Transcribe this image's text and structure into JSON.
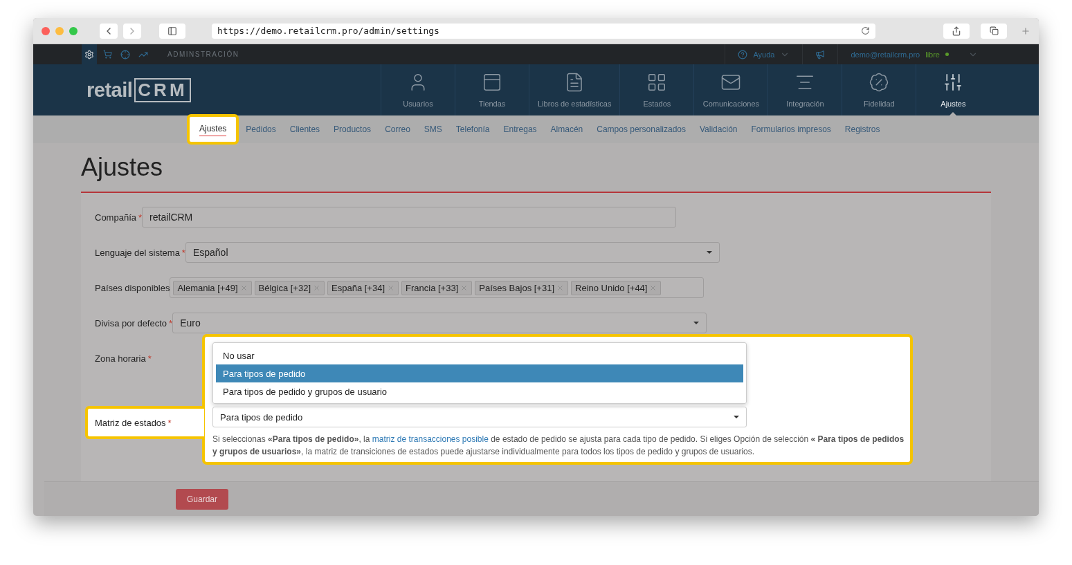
{
  "browser": {
    "url": "https://demo.retailcrm.pro/admin/settings"
  },
  "topbar": {
    "section": "ADMINSTRACIÓN",
    "help": "Ayuda",
    "email": "demo@retailcrm.pro",
    "plan": "libre"
  },
  "logo": {
    "word": "retail",
    "mark": "CRM"
  },
  "nav": [
    {
      "label": "Usuarios",
      "kind": "user",
      "selected": false
    },
    {
      "label": "Tiendas",
      "kind": "store",
      "selected": false
    },
    {
      "label": "Libros de estadísticas",
      "kind": "book",
      "selected": false
    },
    {
      "label": "Estados",
      "kind": "grid",
      "selected": false
    },
    {
      "label": "Comunicaciones",
      "kind": "mail",
      "selected": false
    },
    {
      "label": "Integración",
      "kind": "lines",
      "selected": false
    },
    {
      "label": "Fidelidad",
      "kind": "percent",
      "selected": false
    },
    {
      "label": "Ajustes",
      "kind": "sliders",
      "selected": true
    }
  ],
  "tabs": [
    {
      "label": "Ajustes",
      "selected": true
    },
    {
      "label": "Pedidos",
      "selected": false
    },
    {
      "label": "Clientes",
      "selected": false
    },
    {
      "label": "Productos",
      "selected": false
    },
    {
      "label": "Correo",
      "selected": false
    },
    {
      "label": "SMS",
      "selected": false
    },
    {
      "label": "Telefonía",
      "selected": false
    },
    {
      "label": "Entregas",
      "selected": false
    },
    {
      "label": "Almacén",
      "selected": false
    },
    {
      "label": "Campos personalizados",
      "selected": false
    },
    {
      "label": "Validación",
      "selected": false
    },
    {
      "label": "Formularios impresos",
      "selected": false
    },
    {
      "label": "Registros",
      "selected": false
    }
  ],
  "title": "Ajustes",
  "required_mark": "*",
  "fields": [
    {
      "label": "Compañía",
      "required": true,
      "kind": "text",
      "value": "retailCRM"
    },
    {
      "label": "Lenguaje del sistema",
      "required": true,
      "kind": "select",
      "value": "Español"
    },
    {
      "label": "Países disponibles",
      "required": false,
      "kind": "tags",
      "tags": [
        "Alemania [+49]",
        "Bélgica [+32]",
        "España [+34]",
        "Francia [+33]",
        "Países Bajos [+31]",
        "Reino Unido [+44]"
      ]
    },
    {
      "label": "Divisa por defecto",
      "required": true,
      "kind": "select",
      "value": "Euro"
    },
    {
      "label": "Zona horaria",
      "required": true,
      "kind": "hidden"
    }
  ],
  "matrix": {
    "label": "Matriz de estados",
    "required": true,
    "value": "Para tipos de pedido",
    "options": [
      {
        "label": "No usar",
        "selected": false
      },
      {
        "label": "Para tipos de pedido",
        "selected": true
      },
      {
        "label": "Para tipos de pedido y grupos de usuario",
        "selected": false
      }
    ],
    "help_before": "Si seleccionas **«Para tipos de pedido»**, la ",
    "help_link": "matriz de transacciones posible",
    "help_after": " de estado de pedido se ajusta para cada tipo de pedido. Si eliges Opción de selección **« Para tipos de pedidos y grupos de usuarios»**, la matriz de transiciones de estados puede ajustarse individualmente para todos los tipos de pedido y grupos de usuarios."
  },
  "save_button": "Guardar"
}
